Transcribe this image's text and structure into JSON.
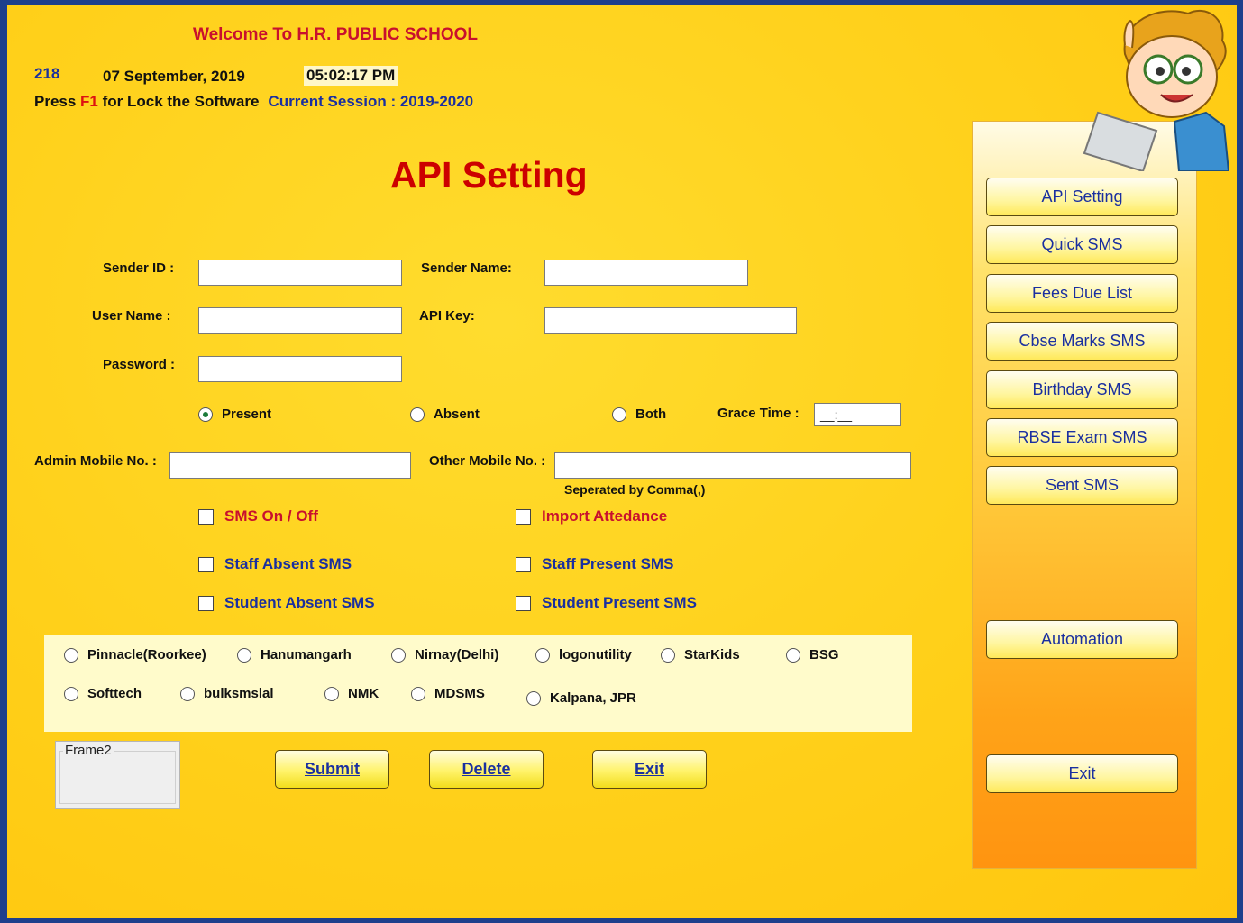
{
  "header": {
    "welcome": "Welcome To  H.R. PUBLIC SCHOOL",
    "number": "218",
    "date": "07 September, 2019",
    "time": "05:02:17 PM",
    "lock_prefix": "Press ",
    "lock_key": "F1",
    "lock_suffix": " for Lock the Software",
    "session": "Current Session : 2019-2020"
  },
  "page_title": "API Setting",
  "form": {
    "sender_id_label": "Sender ID :",
    "sender_id_value": "",
    "sender_name_label": "Sender Name:",
    "sender_name_value": "",
    "user_name_label": "User Name :",
    "user_name_value": "",
    "api_key_label": "API Key:",
    "api_key_value": "",
    "password_label": "Password :",
    "password_value": "",
    "attendance_options": [
      "Present",
      "Absent",
      "Both"
    ],
    "attendance_selected": "Present",
    "grace_time_label": "Grace Time :",
    "grace_time_value": "__:__",
    "admin_mobile_label": "Admin Mobile No. :",
    "admin_mobile_value": "",
    "other_mobile_label": "Other Mobile No. :",
    "other_mobile_value": "",
    "separated_note": "Seperated by Comma(,)"
  },
  "checkboxes": {
    "sms_on_off": "SMS On / Off",
    "import_attendance": "Import Attedance",
    "staff_absent": "Staff Absent SMS",
    "staff_present": "Staff Present SMS",
    "student_absent": "Student Absent SMS",
    "student_present": "Student Present SMS"
  },
  "providers": {
    "row1": [
      "Pinnacle(Roorkee)",
      "Hanumangarh",
      "Nirnay(Delhi)",
      "logonutility",
      "StarKids",
      "BSG"
    ],
    "row2": [
      "Softtech",
      "bulksmslal",
      "NMK",
      "MDSMS",
      "Kalpana, JPR"
    ]
  },
  "frame2_label": "Frame2",
  "actions": {
    "submit": "Submit",
    "delete": "Delete",
    "exit": "Exit"
  },
  "sidebar": {
    "items": [
      "API Setting",
      "Quick SMS",
      "Fees Due List",
      "Cbse Marks SMS",
      "Birthday SMS",
      "RBSE Exam SMS",
      "Sent SMS"
    ],
    "automation": "Automation",
    "exit": "Exit"
  },
  "colors": {
    "background": "#ffd21a",
    "frame": "#1e3f8c",
    "accent_red": "#c8102e",
    "accent_blue": "#1a2fa0"
  }
}
